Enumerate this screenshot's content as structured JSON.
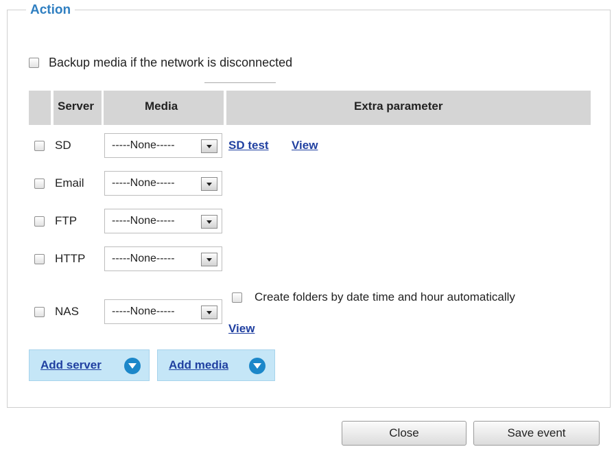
{
  "action": {
    "legend": "Action",
    "backup_label": "Backup media if the network is disconnected",
    "headers": {
      "server": "Server",
      "media": "Media",
      "extra": "Extra parameter"
    },
    "rows": [
      {
        "server": "SD",
        "media": "-----None-----"
      },
      {
        "server": "Email",
        "media": "-----None-----"
      },
      {
        "server": "FTP",
        "media": "-----None-----"
      },
      {
        "server": "HTTP",
        "media": "-----None-----"
      },
      {
        "server": "NAS",
        "media": "-----None-----"
      }
    ],
    "sd_test_label": "SD test",
    "sd_view_label": "View",
    "nas_folder_option": "Create folders by date time and hour automatically",
    "nas_view_label": "View",
    "add_server_label": "Add server",
    "add_media_label": "Add media"
  },
  "footer": {
    "close_label": "Close",
    "save_label": "Save event"
  },
  "colors": {
    "accent": "#2f7fc1",
    "link": "#1f3fa0",
    "add_button_bg": "#c5e6f7",
    "icon_blue": "#1c87c9"
  }
}
